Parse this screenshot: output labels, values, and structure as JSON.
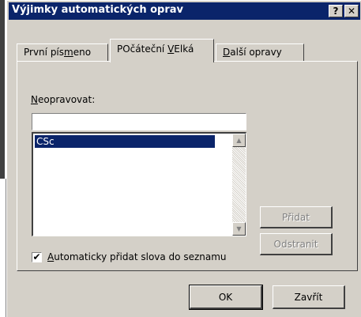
{
  "dialog": {
    "title": "Výjimky automatických oprav",
    "help_label": "?",
    "close_label": "✕"
  },
  "tabs": [
    {
      "label_pre": "První pís",
      "label_u": "m",
      "label_post": "eno"
    },
    {
      "label_pre": "POčáteční ",
      "label_u": "V",
      "label_post": "Elká"
    },
    {
      "label_pre": "",
      "label_u": "D",
      "label_post": "alší opravy"
    }
  ],
  "panel": {
    "field_label_u": "N",
    "field_label_rest": "eopravovat:",
    "input_value": "",
    "list_items": [
      "CSc"
    ],
    "checkbox_checked": true,
    "checkbox_mark": "✔",
    "checkbox_label_u": "A",
    "checkbox_label_rest": "utomaticky přidat slova do seznamu",
    "add_button": "Přidat",
    "remove_button": "Odstranit"
  },
  "footer": {
    "ok_button": "OK",
    "close_button": "Zavřít"
  },
  "icons": {
    "scroll_up": "▲",
    "scroll_down": "▼"
  }
}
